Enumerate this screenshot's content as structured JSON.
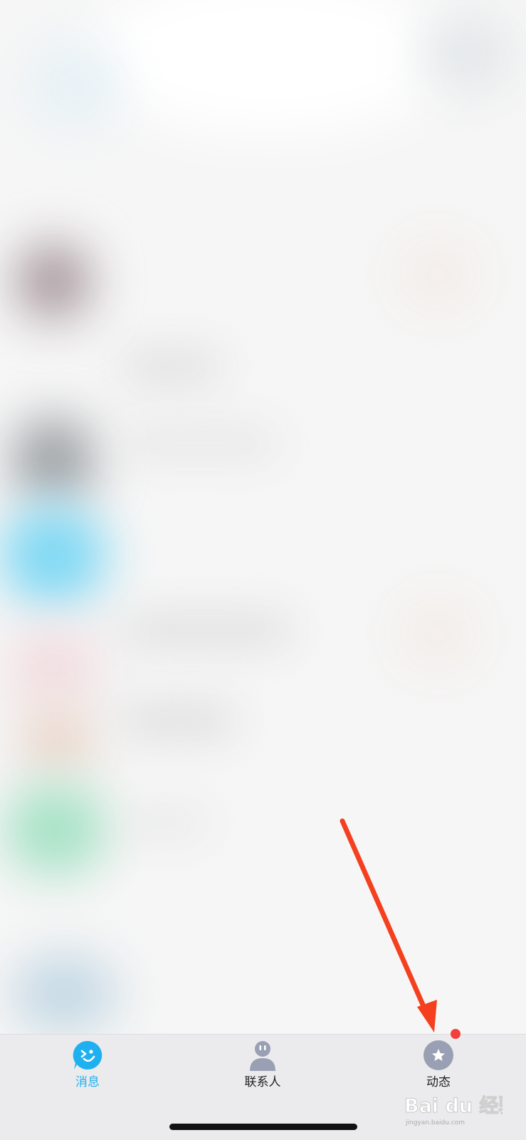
{
  "tabbar": {
    "tabs": [
      {
        "label": "消息",
        "icon": "message-bubble-icon",
        "active": true
      },
      {
        "label": "联系人",
        "icon": "contacts-person-icon",
        "active": false
      },
      {
        "label": "动态",
        "icon": "star-circle-icon",
        "active": false
      }
    ],
    "colors": {
      "active": "#1fb0f0",
      "inactive_icon": "#9aa0b4",
      "badge": "#f2413a",
      "background": "#ebebed"
    }
  },
  "annotation": {
    "arrow_color": "#f4401f",
    "arrow_target": "动态"
  },
  "watermark": {
    "logo_text": "Bai du 经验",
    "url_text": "jingyan.baidu.com"
  }
}
